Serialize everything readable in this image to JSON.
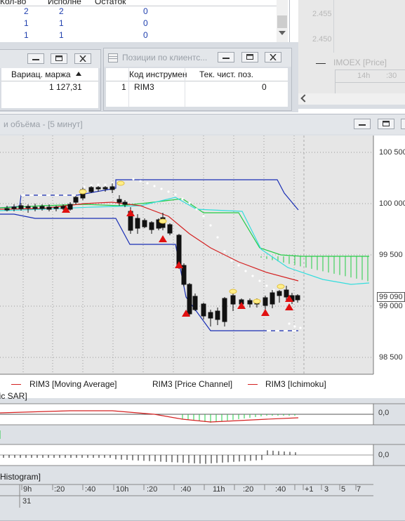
{
  "orders_table": {
    "headers": [
      "Кол-во",
      "Исполне",
      "Остаток"
    ],
    "rows": [
      [
        "2",
        "2",
        "0"
      ],
      [
        "1",
        "1",
        "0"
      ],
      [
        "1",
        "1",
        "0"
      ]
    ]
  },
  "mini_chart": {
    "price_labels": [
      "2.455",
      "2.450"
    ],
    "legend": "IMOEX [Price]",
    "time_labels": [
      "14h",
      ":30"
    ]
  },
  "margin_window": {
    "column_header": "Вариац. маржа",
    "value": "1 127,31"
  },
  "positions_window": {
    "title": "Позиции по клиентс...",
    "headers": [
      "Код инструмен",
      "Тек. чист. поз."
    ],
    "row": {
      "num": "1",
      "code": "RIM3",
      "position": "0"
    }
  },
  "chart_window": {
    "title": "и объёма - [5 минут]",
    "price_labels": [
      "100 500",
      "100 000",
      "99 500",
      "99 000",
      "98 500"
    ],
    "current_price": "99 090",
    "legend": [
      "RIM3 [Moving Average]",
      "RIM3 [Price Channel]",
      "RIM3 [Ichimoku]"
    ],
    "sar_label": "lic SAR]",
    "osc_label": "0,0",
    "hist_label": "0,0",
    "hist_title": "Histogram]",
    "time_labels": [
      "9h",
      ":20",
      ":40",
      "10h",
      ":20",
      ":40",
      "11h",
      ":20",
      ":40",
      "+1",
      "3",
      "5",
      "7"
    ],
    "date_label": "31"
  },
  "colors": {
    "channel": "#1a2fb5",
    "ma": "#d42020",
    "ichimoku_green": "#22cc44",
    "ichimoku_cyan": "#33dddd",
    "sar": "#ffffff",
    "background": "#e6e6e6"
  }
}
